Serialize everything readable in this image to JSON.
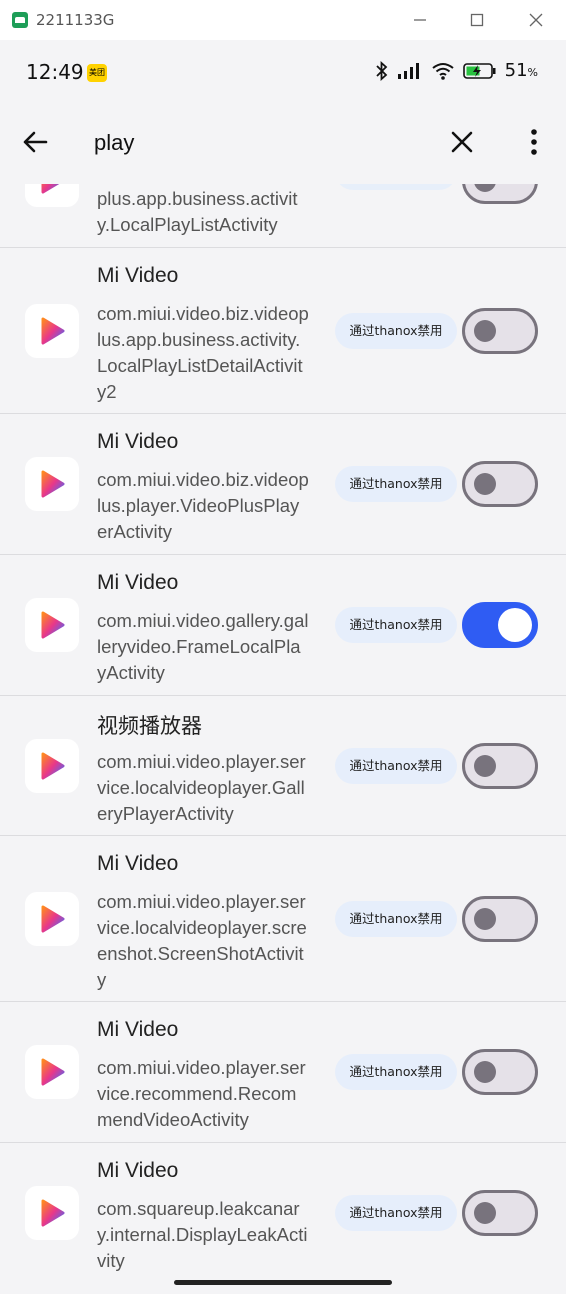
{
  "window": {
    "title": "2211133G"
  },
  "status_bar": {
    "time": "12:49",
    "app_badge": "美团",
    "battery_percent": "51",
    "battery_unit": "%"
  },
  "search": {
    "query": "play"
  },
  "rows": [
    {
      "name": "",
      "component": "plus.app.business.activity.LocalPlayListActivity",
      "chip": "",
      "enabled": false
    },
    {
      "name": "Mi Video",
      "component": "com.miui.video.biz.videoplus.app.business.activity.LocalPlayListDetailActivity2",
      "chip": "通过thanox禁用",
      "enabled": false
    },
    {
      "name": "Mi Video",
      "component": "com.miui.video.biz.videoplus.player.VideoPlusPlayerActivity",
      "chip": "通过thanox禁用",
      "enabled": false
    },
    {
      "name": "Mi Video",
      "component": "com.miui.video.gallery.galleryvideo.FrameLocalPlayActivity",
      "chip": "通过thanox禁用",
      "enabled": true
    },
    {
      "name": "视频播放器",
      "component": "com.miui.video.player.service.localvideoplayer.GalleryPlayerActivity",
      "chip": "通过thanox禁用",
      "enabled": false
    },
    {
      "name": "Mi Video",
      "component": "com.miui.video.player.service.localvideoplayer.screenshot.ScreenShotActivity",
      "chip": "通过thanox禁用",
      "enabled": false
    },
    {
      "name": "Mi Video",
      "component": "com.miui.video.player.service.recommend.RecommendVideoActivity",
      "chip": "通过thanox禁用",
      "enabled": false
    },
    {
      "name": "Mi Video",
      "component": "com.squareup.leakcanary.internal.DisplayLeakActivity",
      "chip": "通过thanox禁用",
      "enabled": false
    }
  ]
}
